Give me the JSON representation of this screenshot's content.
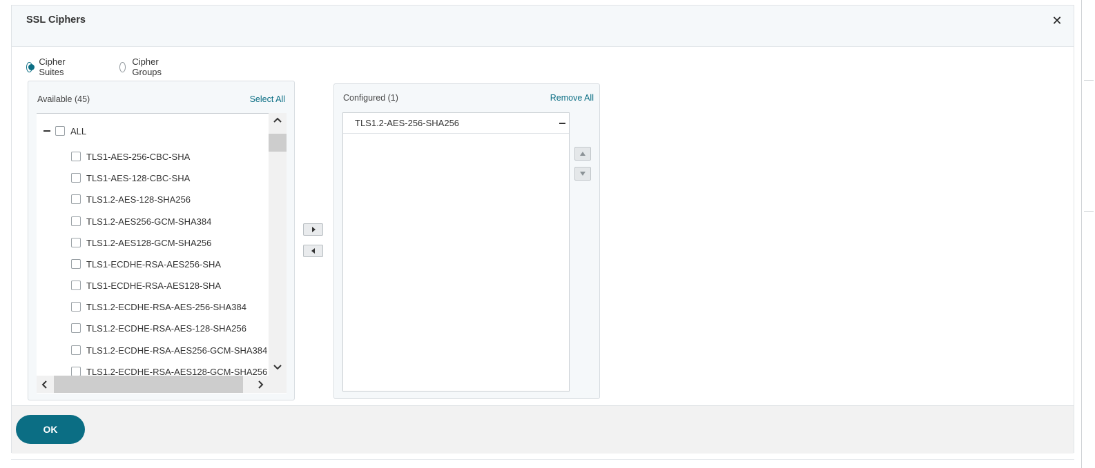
{
  "dialog": {
    "title": "SSL Ciphers",
    "close_icon": "close-icon"
  },
  "mode": {
    "options": [
      {
        "label": "Cipher Suites",
        "checked": true
      },
      {
        "label": "Cipher Groups",
        "checked": false
      }
    ]
  },
  "available": {
    "title": "Available (45)",
    "select_all_label": "Select All",
    "all_label": "ALL",
    "items": [
      "TLS1-AES-256-CBC-SHA",
      "TLS1-AES-128-CBC-SHA",
      "TLS1.2-AES-128-SHA256",
      "TLS1.2-AES256-GCM-SHA384",
      "TLS1.2-AES128-GCM-SHA256",
      "TLS1-ECDHE-RSA-AES256-SHA",
      "TLS1-ECDHE-RSA-AES128-SHA",
      "TLS1.2-ECDHE-RSA-AES-256-SHA384",
      "TLS1.2-ECDHE-RSA-AES-128-SHA256",
      "TLS1.2-ECDHE-RSA-AES256-GCM-SHA384",
      "TLS1.2-ECDHE-RSA-AES128-GCM-SHA256"
    ]
  },
  "configured": {
    "title": "Configured (1)",
    "remove_all_label": "Remove All",
    "items": [
      "TLS1.2-AES-256-SHA256"
    ]
  },
  "footer": {
    "ok_label": "OK"
  },
  "colors": {
    "accent": "#0b6e84",
    "header_bg": "#f5f8fa",
    "footer_bg": "#f2f2f2"
  }
}
